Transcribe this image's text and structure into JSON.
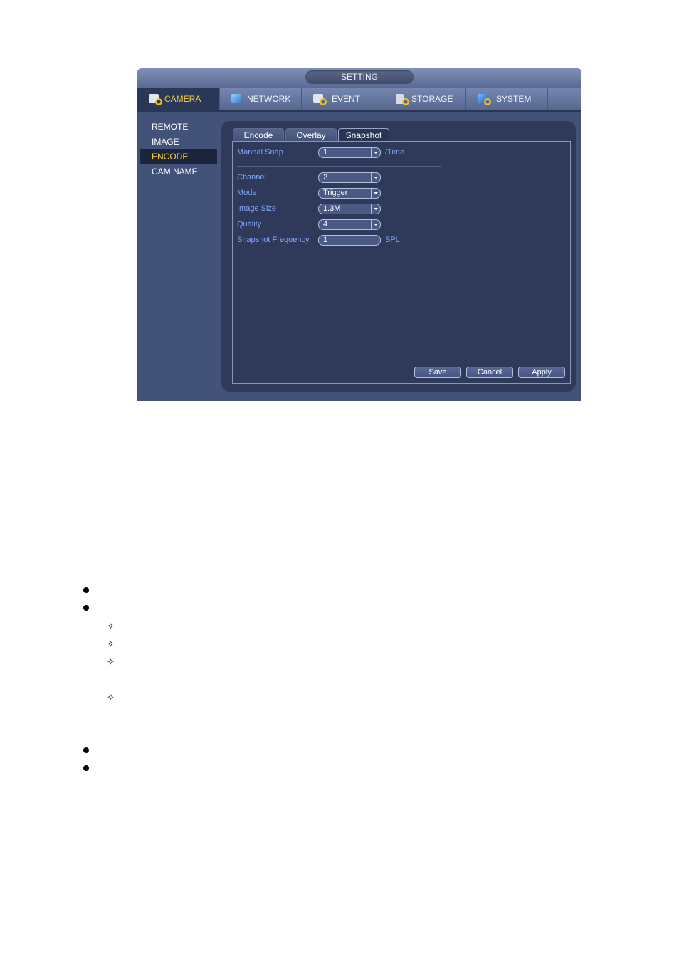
{
  "window": {
    "title": "SETTING"
  },
  "menubar": {
    "items": [
      {
        "label": "CAMERA",
        "icon": "camera-icon",
        "active": true
      },
      {
        "label": "NETWORK",
        "icon": "network-icon",
        "active": false
      },
      {
        "label": "EVENT",
        "icon": "event-icon",
        "active": false
      },
      {
        "label": "STORAGE",
        "icon": "storage-icon",
        "active": false
      },
      {
        "label": "SYSTEM",
        "icon": "system-icon",
        "active": false
      }
    ]
  },
  "sidebar": {
    "items": [
      {
        "label": "REMOTE",
        "active": false
      },
      {
        "label": "IMAGE",
        "active": false
      },
      {
        "label": "ENCODE",
        "active": true
      },
      {
        "label": "CAM NAME",
        "active": false
      }
    ]
  },
  "tabs": [
    {
      "label": "Encode",
      "active": false
    },
    {
      "label": "Overlay",
      "active": false
    },
    {
      "label": "Snapshot",
      "active": true
    }
  ],
  "form": {
    "manual_snap": {
      "label": "Mannal Snap",
      "value": "1",
      "suffix": "/Time"
    },
    "channel": {
      "label": "Channel",
      "value": "2"
    },
    "mode": {
      "label": "Mode",
      "value": "Trigger"
    },
    "image_size": {
      "label": "Image Size",
      "value": "1.3M"
    },
    "quality": {
      "label": "Quality",
      "value": "4"
    },
    "snapshot_frequency": {
      "label": "Snapshot Frequency",
      "value": "1",
      "suffix": "SPL"
    }
  },
  "buttons": {
    "save": "Save",
    "cancel": "Cancel",
    "apply": "Apply"
  },
  "document": {
    "bullet_glyph": "●",
    "sub_bullet_glyph": "✧"
  },
  "colors": {
    "active_menu_text": "#f5d234",
    "label_text": "#7fa8ff",
    "window_bg": "#425278",
    "panel_bg": "#2f3a5a"
  }
}
